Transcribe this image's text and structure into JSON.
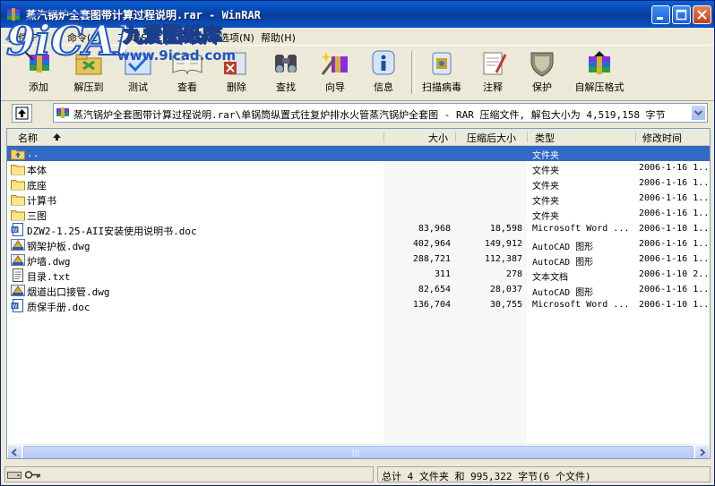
{
  "window": {
    "title": "蒸汽锅炉全套图带计算过程说明.rar - WinRAR"
  },
  "watermark": {
    "logo_text": "9iCAD",
    "chinese": "九爱图纸库",
    "url": "www.9icad.com"
  },
  "menu": {
    "items": [
      "文件(F)",
      "命令(C)",
      "工具(S)",
      "收藏夹(O)",
      "选项(N)",
      "帮助(H)"
    ]
  },
  "toolbar": {
    "buttons": [
      {
        "label": "添加",
        "icon": "add-icon"
      },
      {
        "label": "解压到",
        "icon": "extract-icon"
      },
      {
        "label": "测试",
        "icon": "test-icon"
      },
      {
        "label": "查看",
        "icon": "view-icon"
      },
      {
        "label": "删除",
        "icon": "delete-icon"
      },
      {
        "label": "查找",
        "icon": "find-icon"
      },
      {
        "label": "向导",
        "icon": "wizard-icon"
      },
      {
        "label": "信息",
        "icon": "info-icon"
      },
      {
        "label": "扫描病毒",
        "icon": "virus-scan-icon"
      },
      {
        "label": "注释",
        "icon": "comment-icon"
      },
      {
        "label": "保护",
        "icon": "protect-icon"
      },
      {
        "label": "自解压格式",
        "icon": "sfx-icon"
      }
    ]
  },
  "address": {
    "path": "蒸汽锅炉全套图带计算过程说明.rar\\单锅筒纵置式往复炉排水火管蒸汽锅炉全套图 - RAR 压缩文件, 解包大小为 4,519,158 字节"
  },
  "columns": {
    "name": "名称",
    "size": "大小",
    "packed": "压缩后大小",
    "type": "类型",
    "modified": "修改时间"
  },
  "files": [
    {
      "name": "..",
      "size": "",
      "packed": "",
      "type": "文件夹",
      "modified": "",
      "icon": "folder-up-icon",
      "selected": true
    },
    {
      "name": "本体",
      "size": "",
      "packed": "",
      "type": "文件夹",
      "modified": "2006-1-16 1...",
      "icon": "folder-icon"
    },
    {
      "name": "底座",
      "size": "",
      "packed": "",
      "type": "文件夹",
      "modified": "2006-1-16 1...",
      "icon": "folder-icon"
    },
    {
      "name": "计算书",
      "size": "",
      "packed": "",
      "type": "文件夹",
      "modified": "2006-1-16 1...",
      "icon": "folder-icon"
    },
    {
      "name": "三图",
      "size": "",
      "packed": "",
      "type": "文件夹",
      "modified": "2006-1-16 1...",
      "icon": "folder-icon"
    },
    {
      "name": "DZW2-1.25-AII安装使用说明书.doc",
      "size": "83,968",
      "packed": "18,598",
      "type": "Microsoft Word ...",
      "modified": "2006-1-10 1...",
      "icon": "word-doc-icon"
    },
    {
      "name": "钢架护板.dwg",
      "size": "402,964",
      "packed": "149,912",
      "type": "AutoCAD 图形",
      "modified": "2006-1-16 1...",
      "icon": "dwg-icon"
    },
    {
      "name": "炉墙.dwg",
      "size": "288,721",
      "packed": "112,387",
      "type": "AutoCAD 图形",
      "modified": "2006-1-16 1...",
      "icon": "dwg-icon"
    },
    {
      "name": "目录.txt",
      "size": "311",
      "packed": "278",
      "type": "文本文档",
      "modified": "2006-1-10 2...",
      "icon": "txt-icon"
    },
    {
      "name": "烟道出口接管.dwg",
      "size": "82,654",
      "packed": "28,037",
      "type": "AutoCAD 图形",
      "modified": "2006-1-16 1...",
      "icon": "dwg-icon"
    },
    {
      "name": "质保手册.doc",
      "size": "136,704",
      "packed": "30,755",
      "type": "Microsoft Word ...",
      "modified": "2006-1-10 1...",
      "icon": "word-doc-icon"
    }
  ],
  "status": {
    "summary": "总计 4 文件夹 和 995,322 字节(6 个文件)"
  }
}
